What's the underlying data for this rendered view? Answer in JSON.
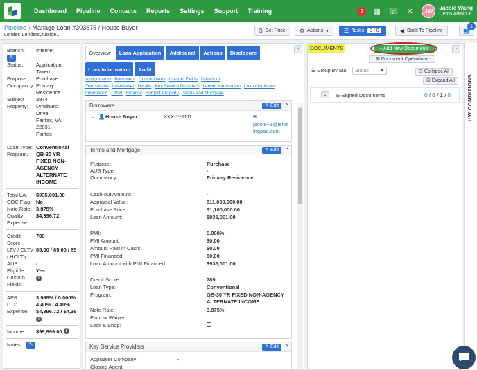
{
  "nav": {
    "items": [
      "Dashboard",
      "Pipeline",
      "Contacts",
      "Reports",
      "Settings",
      "Support",
      "Training"
    ],
    "user_initials": "JW",
    "user_name": "Jacole Wang",
    "user_role": "Demo Admin"
  },
  "header": {
    "crumb_pipeline": "Pipeline",
    "crumb_current": "Manage Loan #303675 / House Buyer",
    "lender": "Lender: LendersOutside1",
    "get_price": "Get Price",
    "actions": "Actions",
    "tasks": "Tasks",
    "tasks_count": "0 / 0",
    "back": "Back To Pipeline",
    "notif_count": "1"
  },
  "left": {
    "branch_k": "Branch:",
    "branch_v": "Internet",
    "status_k": "Status:",
    "status_v": "Application\nTaken",
    "purpose_k": "Purpose:",
    "purpose_v": "Purchase",
    "occupancy_k": "Occupancy:",
    "occupancy_v": "Primary\nResidence",
    "subject_k": "Subject\nProperty:",
    "subject_v": "3874\nLyndhurst\nDrive\nFairfax, VA\n22031\nFairfax",
    "loantype_k": "Loan Type:",
    "loantype_v": "Conventional",
    "program_k": "Program:",
    "program_v": "QB-30 YR\nFIXED NON-\nAGENCY\nALTERNATE\nINCOME",
    "totalla_k": "Total LA:",
    "totalla_v": "$935,001.00",
    "coc_k": "COC Flag:",
    "coc_v": "No",
    "noterate_k": "Note Rate:",
    "noterate_v": "3.875%",
    "qualexp_k": "Quality\nExpense:",
    "qualexp_v": "$4,396.72",
    "credit_k": "Credit\nScore:",
    "credit_v": "789",
    "ltv_k": "LTV / CLTV\n/ HCLTV:",
    "ltv_v": "85.00 / 85.00 / 85",
    "aus_k": "AUS:",
    "aus_v": "-",
    "eligible_k": "Eligible:",
    "eligible_v": "Yes",
    "custom_k": "Custom\nFields:",
    "apr_k": "APR:",
    "apr_v": "3.968% / 0.000%",
    "dti_k": "DTI:",
    "dti_v": "4.40% / 4.40%",
    "expense_k": "Expense:",
    "expense_v": "$4,396.72 / $4,39",
    "income_k": "Income:",
    "income_v": "$99,999.00",
    "notes_k": "Notes:"
  },
  "tabs": [
    "Overview",
    "Loan Application",
    "Additional",
    "Actions",
    "Disclosure",
    "Lock Information",
    "Audit"
  ],
  "links": [
    "Assignments",
    "Borrowers",
    "Critical Dates",
    "Custom Fields",
    "Details of Transaction",
    "Interviewer",
    "Details",
    "Key Service Providers",
    "Lender Information",
    "Loan Originator Information",
    "Other",
    "Finance",
    "Subject Property",
    "Terms and Mortgage"
  ],
  "borrowers": {
    "title": "Borrowers",
    "edit": "Edit",
    "name": "House Buyer",
    "ssn": "XXX-**-1111",
    "email": "jacole+1@lendingpad.com"
  },
  "terms": {
    "title": "Terms and Mortgage",
    "edit": "Edit",
    "purpose_k": "Purpose:",
    "purpose_v": "Purchase",
    "aus_k": "AUS Type:",
    "aus_v": "-",
    "occ_k": "Occupancy:",
    "occ_v": "Primary Residence",
    "cashout_k": "Cash-out Amount:",
    "cashout_v": "-",
    "appraisal_k": "Appraisal Value:",
    "appraisal_v": "$11,000,000.00",
    "price_k": "Purchase Price:",
    "price_v": "$1,100,000.00",
    "loanamt_k": "Loan Amount:",
    "loanamt_v": "$935,001.00",
    "pmi_k": "PMI:",
    "pmi_v": "0.000%",
    "pmiamt_k": "PMI Amount:",
    "pmiamt_v": "$0.00",
    "paidcash_k": "Amount Paid in Cash:",
    "paidcash_v": "$0.00",
    "pmifin_k": "PMI Financed:",
    "pmifin_v": "$0.00",
    "withpmi_k": "Loan Amount with PMI Financed:",
    "withpmi_v": "$935,001.00",
    "credit_k": "Credit Score:",
    "credit_v": "789",
    "loantype_k": "Loan Type:",
    "loantype_v": "Conventional",
    "program_k": "Program:",
    "program_v": "QB-30 YR FIXED NON-AGENCY\nALTERNATE INCOME",
    "rate_k": "Note Rate:",
    "rate_v": "3.875%",
    "escrow_k": "Escrow Waiver:",
    "lock_k": "Lock & Shop:"
  },
  "ksp": {
    "title": "Key Service Providers",
    "edit": "Edit",
    "appraiser_k": "Appraiser Company:",
    "appraiser_v": "-",
    "closing_k": "Closing Agent:",
    "closing_v": "-"
  },
  "docs": {
    "label": "DOCUMENTS",
    "add": "+ Add New Documents",
    "ops": "Document Operations",
    "group_by": "Group By Sta",
    "status_placeholder": "Status",
    "collapse_all": "Collapse All",
    "expand_all": "Expand All",
    "esign_label": "E-Signed Documents",
    "esign_c1": "0",
    "esign_c2": "0",
    "esign_c3": "1",
    "esign_c4": "0"
  },
  "uw": {
    "label": "UW CONDITIONS"
  },
  "colors": {
    "nav_green": "#2e9a43",
    "primary_blue": "#2f6fd6",
    "add_green": "#3aaa55",
    "highlight": "#f6f04a",
    "circle_red": "#c0282a"
  }
}
